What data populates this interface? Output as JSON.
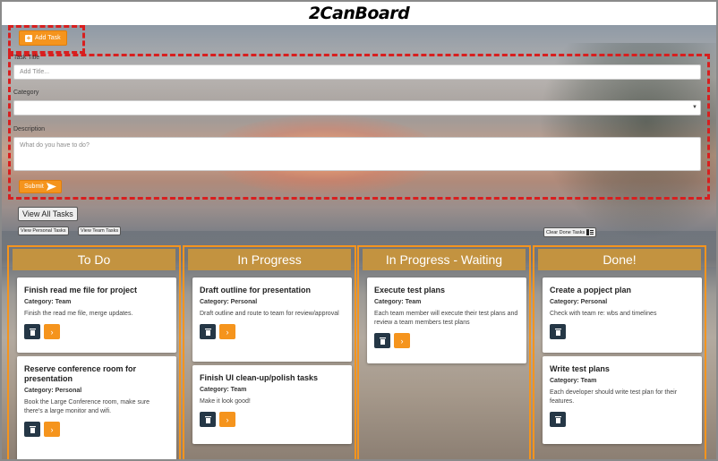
{
  "app": {
    "logo_text": "2CanBoard"
  },
  "form": {
    "add_task_label": "Add Task",
    "title_label": "Task Title",
    "title_placeholder": "Add Title...",
    "category_label": "Category",
    "category_value": "",
    "description_label": "Description",
    "description_placeholder": "What do you have to do?",
    "submit_label": "Submit"
  },
  "filters": {
    "view_all": "View All Tasks",
    "view_personal": "View Personal Tasks",
    "view_team": "View Team Tasks",
    "clear_done": "Clear Done Tasks"
  },
  "columns": [
    {
      "title": "To Do",
      "cards": [
        {
          "title": "Finish read me file for project",
          "category": "Category: Team",
          "description": "Finish the read me file, merge updates."
        },
        {
          "title": "Reserve conference room for presentation",
          "category": "Category: Personal",
          "description": "Book the Large Conference room, make sure there's a large monitor and wifi."
        }
      ]
    },
    {
      "title": "In Progress",
      "cards": [
        {
          "title": "Draft outline for presentation",
          "category": "Category: Personal",
          "description": "Draft outline and route to team for review/approval"
        },
        {
          "title": "Finish UI clean-up/polish tasks",
          "category": "Category: Team",
          "description": "Make it look good!"
        }
      ]
    },
    {
      "title": "In Progress - Waiting",
      "cards": [
        {
          "title": "Execute test plans",
          "category": "Category: Team",
          "description": "Each team member will execute their test plans and review a team members test plans"
        }
      ]
    },
    {
      "title": "Done!",
      "cards": [
        {
          "title": "Create a popject plan",
          "category": "Category: Personal",
          "description": "Check with team re: wbs and timelines"
        },
        {
          "title": "Write test plans",
          "category": "Category: Team",
          "description": "Each developer should write test plan for their features."
        }
      ]
    }
  ],
  "colors": {
    "accent": "#f5941d",
    "column_header": "#c39340",
    "dark_button": "#253746",
    "highlight_dash": "#d81f1f"
  },
  "icons": {
    "add": "plus-square-icon",
    "submit": "send-arrow-icon",
    "delete": "trash-icon",
    "advance": "chevron-right-icon",
    "clear": "broom-icon",
    "select": "caret-down-icon"
  }
}
